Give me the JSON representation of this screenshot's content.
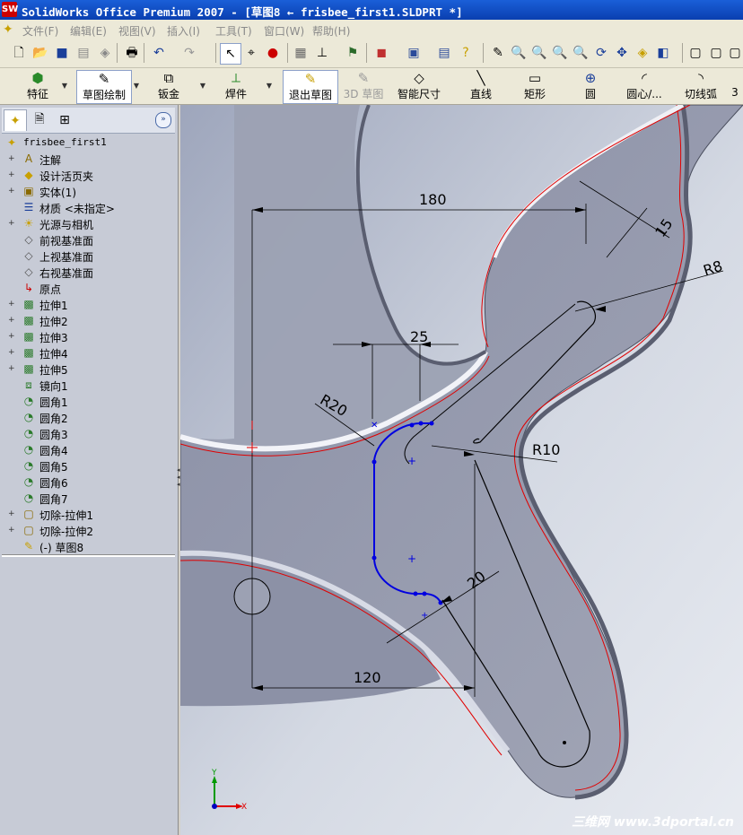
{
  "window": {
    "app_icon_text": "SW",
    "title": "SolidWorks Office Premium 2007 - [草图8 ← frisbee_first1.SLDPRT *]"
  },
  "menubar": {
    "items": [
      "文件(F)",
      "编辑(E)",
      "视图(V)",
      "插入(I)",
      "工具(T)",
      "窗口(W)",
      "帮助(H)"
    ]
  },
  "commandmanager": {
    "buttons": [
      {
        "label": "特征",
        "icon": "feature-icon"
      },
      {
        "label": "草图绘制",
        "icon": "sketch-icon"
      },
      {
        "label": "钣金",
        "icon": "sheetmetal-icon"
      },
      {
        "label": "焊件",
        "icon": "weldment-icon"
      },
      {
        "label": "退出草图",
        "icon": "exit-sketch-icon"
      },
      {
        "label": "3D 草图",
        "icon": "3d-sketch-icon"
      },
      {
        "label": "智能尺寸",
        "icon": "smart-dimension-icon"
      },
      {
        "label": "直线",
        "icon": "line-icon"
      },
      {
        "label": "矩形",
        "icon": "rectangle-icon"
      },
      {
        "label": "圆",
        "icon": "circle-icon"
      },
      {
        "label": "圆心/...",
        "icon": "centerpoint-arc-icon"
      },
      {
        "label": "切线弧",
        "icon": "tangent-arc-icon"
      },
      {
        "label": "3",
        "icon": ""
      }
    ]
  },
  "feature_tree": {
    "root": "frisbee_first1",
    "items": [
      {
        "label": "注解",
        "icon": "annotations-icon",
        "expandable": true
      },
      {
        "label": "设计活页夹",
        "icon": "design-binder-icon",
        "expandable": true
      },
      {
        "label": "实体(1)",
        "icon": "solid-bodies-icon",
        "expandable": true
      },
      {
        "label": "材质 <未指定>",
        "icon": "material-icon",
        "expandable": false
      },
      {
        "label": "光源与相机",
        "icon": "lights-cameras-icon",
        "expandable": true
      },
      {
        "label": "前视基准面",
        "icon": "plane-icon",
        "expandable": false
      },
      {
        "label": "上视基准面",
        "icon": "plane-icon",
        "expandable": false
      },
      {
        "label": "右视基准面",
        "icon": "plane-icon",
        "expandable": false
      },
      {
        "label": "原点",
        "icon": "origin-icon",
        "expandable": false
      },
      {
        "label": "拉伸1",
        "icon": "extrude-icon",
        "expandable": true
      },
      {
        "label": "拉伸2",
        "icon": "extrude-icon",
        "expandable": true
      },
      {
        "label": "拉伸3",
        "icon": "extrude-icon",
        "expandable": true
      },
      {
        "label": "拉伸4",
        "icon": "extrude-icon",
        "expandable": true
      },
      {
        "label": "拉伸5",
        "icon": "extrude-icon",
        "expandable": true
      },
      {
        "label": "镜向1",
        "icon": "mirror-icon",
        "expandable": false
      },
      {
        "label": "圆角1",
        "icon": "fillet-icon",
        "expandable": false
      },
      {
        "label": "圆角2",
        "icon": "fillet-icon",
        "expandable": false
      },
      {
        "label": "圆角3",
        "icon": "fillet-icon",
        "expandable": false
      },
      {
        "label": "圆角4",
        "icon": "fillet-icon",
        "expandable": false
      },
      {
        "label": "圆角5",
        "icon": "fillet-icon",
        "expandable": false
      },
      {
        "label": "圆角6",
        "icon": "fillet-icon",
        "expandable": false
      },
      {
        "label": "圆角7",
        "icon": "fillet-icon",
        "expandable": false
      },
      {
        "label": "切除-拉伸1",
        "icon": "cut-extrude-icon",
        "expandable": true
      },
      {
        "label": "切除-拉伸2",
        "icon": "cut-extrude-icon",
        "expandable": true
      },
      {
        "label": "(-) 草图8",
        "icon": "sketch-icon",
        "expandable": false
      }
    ]
  },
  "dimensions": {
    "d180": "180",
    "d15": "15",
    "r8": "R8",
    "d25": "25",
    "r20": "R20",
    "r10": "R10",
    "d20": "20",
    "d120": "120"
  },
  "triad": {
    "y_label": "Y",
    "x_label": "X"
  },
  "watermark": "三维网 www.3dportal.cn",
  "colors": {
    "title_bar": "#0a3fb0",
    "viewport_bg": "#c8cfdc",
    "part_face": "#9a9fb0",
    "edge_red": "#e00000",
    "sketch_blue": "#0000e0"
  }
}
